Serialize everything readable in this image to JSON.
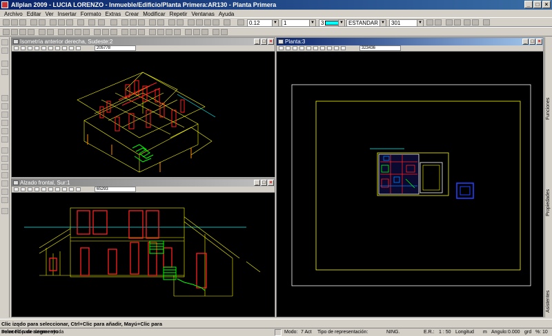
{
  "window": {
    "title": "Allplan 2009 - LUCIA LORENZO - Inmueble/Edificio/Planta Primera:AR130 - Planta Primera"
  },
  "menu": [
    "Archivo",
    "Editar",
    "Ver",
    "Insertar",
    "Formato",
    "Extras",
    "Crear",
    "Modificar",
    "Repetir",
    "Ventanas",
    "Ayuda"
  ],
  "toolbar": {
    "pen_value": "0.12",
    "line_value": "1",
    "color_value": "3",
    "layer_value": "ESTANDAR",
    "hatch_value": "301",
    "accent_color": "#00ffff"
  },
  "viewports": {
    "iso": {
      "title": "Isometría anterior derecha, Sudeste:2",
      "scale": "205778"
    },
    "elev": {
      "title": "Alzado frontal, Sur:1",
      "scale": "65293"
    },
    "plan": {
      "title": "Planta:3",
      "scale": "323436"
    }
  },
  "side_tabs": [
    "Funciones",
    "Propiedades",
    "Asistentes"
  ],
  "prompt": {
    "text": "Clic izqdo para seleccionar, Ctrl+Clic para añadir, Mayú+Clic para selección de segmento"
  },
  "status": {
    "help": "Pulse F1 para obtener ayuda",
    "mode_label": "Modo:",
    "mode_value": "7 Act",
    "rep_label": "Tipo de representación:",
    "ning": "NING.",
    "er_label": "E.R.:",
    "er_value": "1 : 50",
    "length_label": "Longitud",
    "length_value": "m",
    "angle_label": "Angulo:",
    "angle_value": "0.000",
    "grade_unit": "grd",
    "percent_label": "%:",
    "percent_value": "10"
  }
}
